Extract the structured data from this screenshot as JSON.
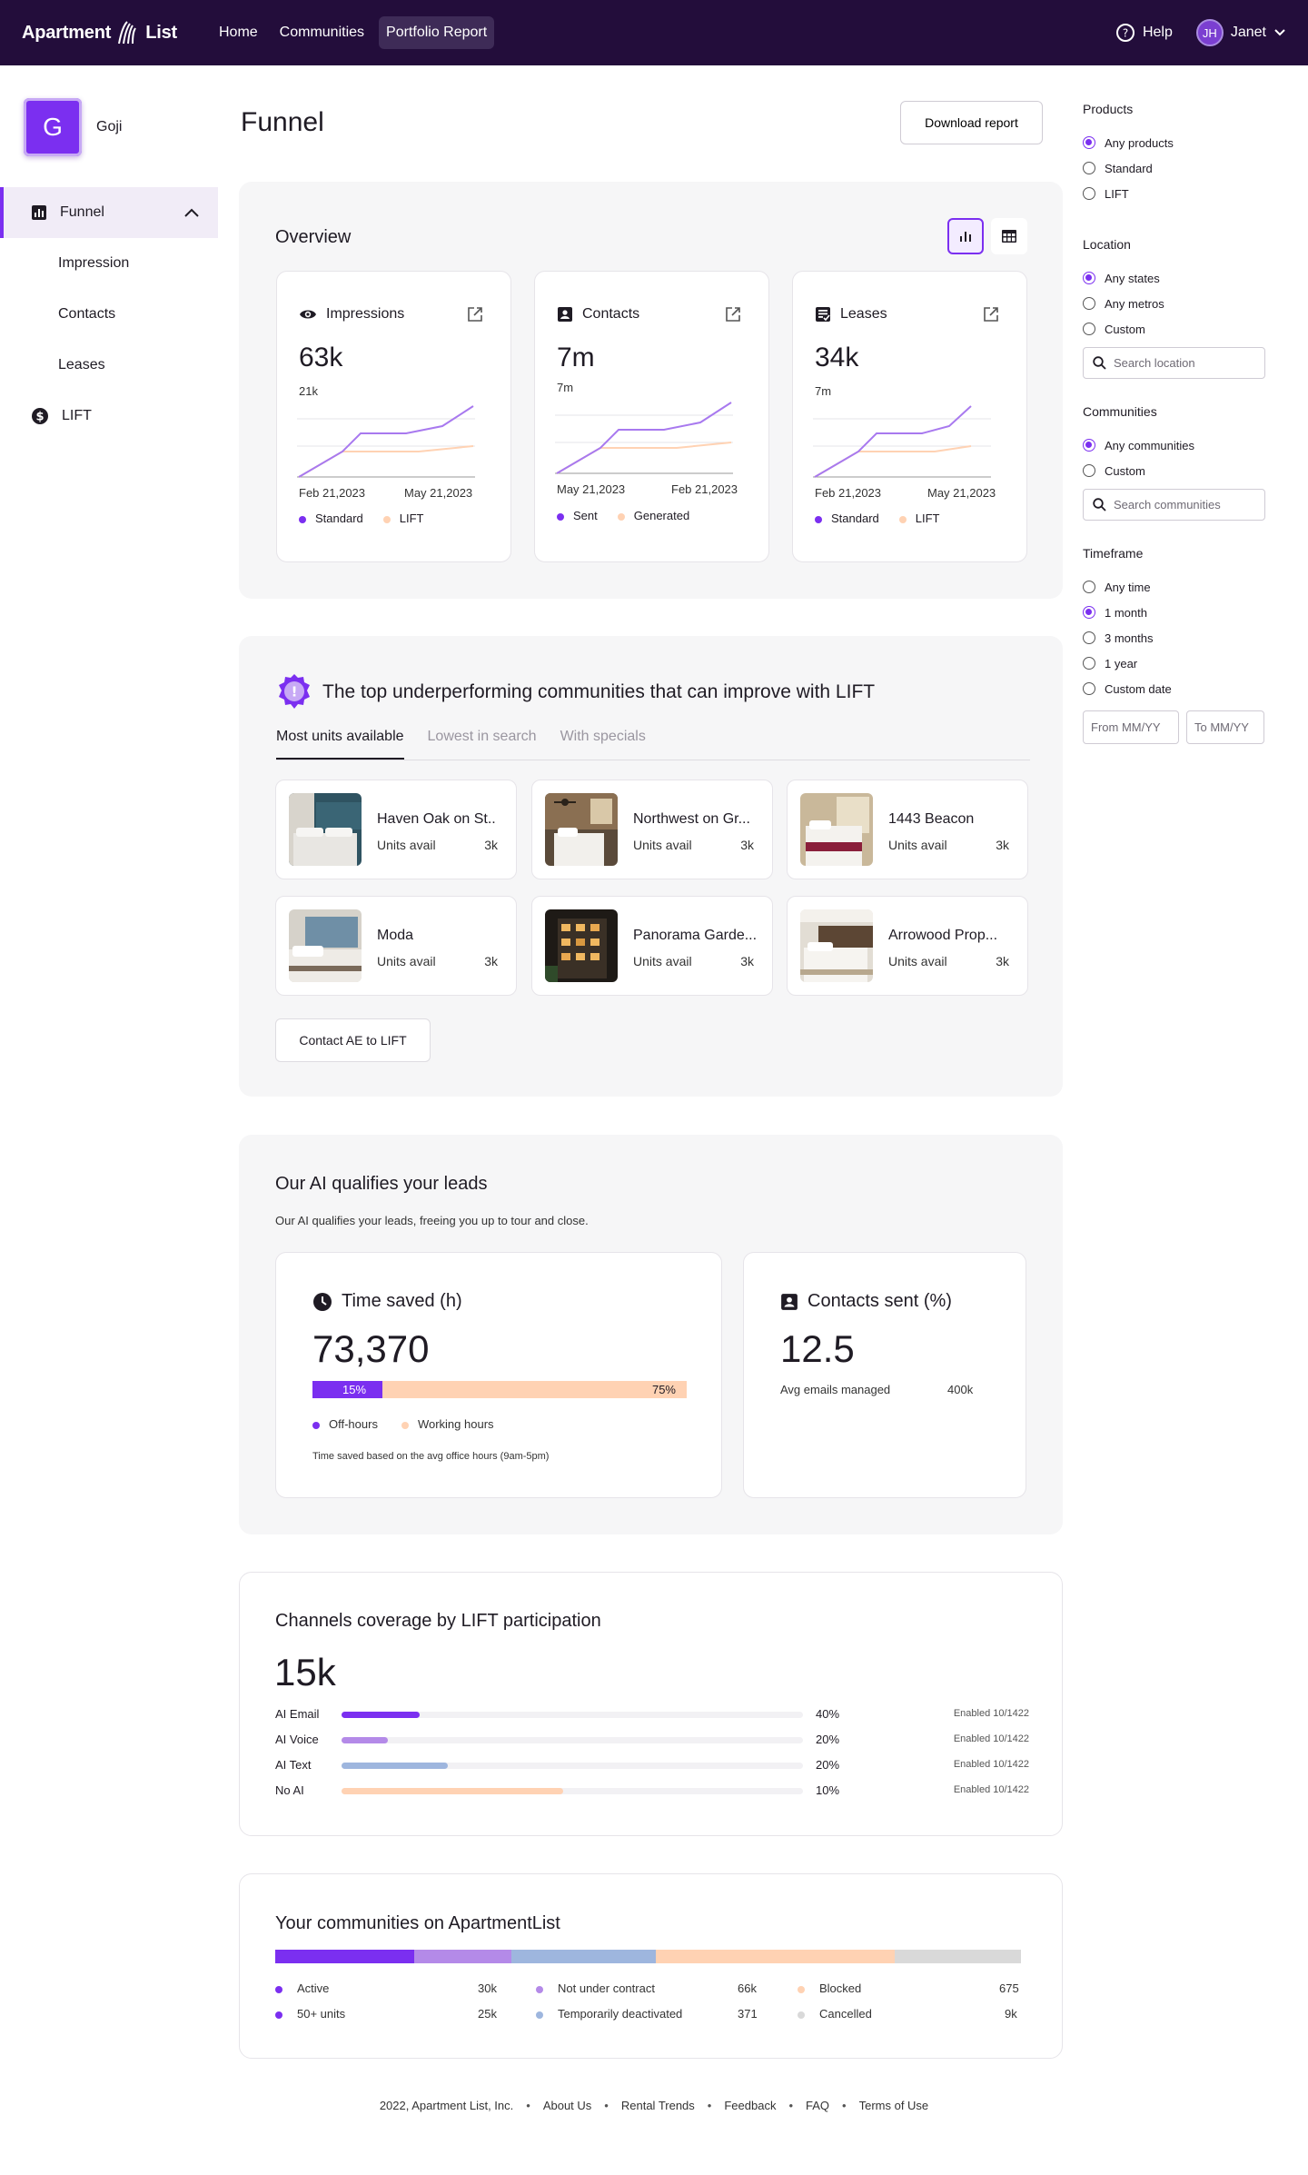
{
  "nav": {
    "logo": "Apartment List",
    "links": [
      "Home",
      "Communities",
      "Portfolio Report"
    ],
    "help": "Help",
    "user_initials": "JH",
    "user_name": "Janet"
  },
  "sidebar": {
    "company_initial": "G",
    "company_name": "Goji",
    "funnel": "Funnel",
    "sub": [
      "Impression",
      "Contacts",
      "Leases"
    ],
    "lift": "LIFT"
  },
  "page": {
    "title": "Funnel",
    "download": "Download report"
  },
  "overview": {
    "title": "Overview",
    "cards": [
      {
        "title": "Impressions",
        "value": "63k",
        "sub": "21k",
        "date_left": "Feb 21,2023",
        "date_right": "May 21,2023",
        "legend": [
          "Standard",
          "LIFT"
        ]
      },
      {
        "title": "Contacts",
        "value": "7m",
        "sub": "7m",
        "date_left": "May 21,2023",
        "date_right": "Feb 21,2023",
        "legend": [
          "Sent",
          "Generated"
        ]
      },
      {
        "title": "Leases",
        "value": "34k",
        "sub": "7m",
        "date_left": "Feb 21,2023",
        "date_right": "May 21,2023",
        "legend": [
          "Standard",
          "LIFT"
        ]
      }
    ]
  },
  "under": {
    "title": "The top underperforming communities that can improve with LIFT",
    "tabs": [
      "Most units available",
      "Lowest in search",
      "With specials"
    ],
    "unit_label": "Units avail",
    "communities": [
      {
        "name": "Haven Oak on St..",
        "units": "3k"
      },
      {
        "name": "Northwest on Gr...",
        "units": "3k"
      },
      {
        "name": "1443 Beacon",
        "units": "3k"
      },
      {
        "name": "Moda",
        "units": "3k"
      },
      {
        "name": "Panorama Garde...",
        "units": "3k"
      },
      {
        "name": "Arrowood Prop...",
        "units": "3k"
      }
    ],
    "contact_btn": "Contact AE to LIFT"
  },
  "ai": {
    "title": "Our AI qualifies your leads",
    "subtitle": "Our AI qualifies your leads, freeing you up to tour and close.",
    "time_title": "Time saved (h)",
    "time_value": "73,370",
    "offhours_pct": 15,
    "offhours_label": "15%",
    "working_label": "75%",
    "legend": [
      "Off-hours",
      "Working hours"
    ],
    "note": "Time saved based on the avg office hours (9am-5pm)",
    "contacts_title": "Contacts sent (%)",
    "contacts_value": "12.5",
    "emails_label": "Avg emails managed",
    "emails_value": "400k"
  },
  "channels": {
    "title": "Channels coverage by LIFT participation",
    "value": "15k",
    "rows": [
      {
        "label": "AI Email",
        "pct": "40%",
        "fill": 17,
        "color": "#7b2ff0",
        "enabled": "Enabled 10/1422"
      },
      {
        "label": "AI Voice",
        "pct": "20%",
        "fill": 10,
        "color": "#b48ae8",
        "enabled": "Enabled 10/1422"
      },
      {
        "label": "AI Text",
        "pct": "20%",
        "fill": 23,
        "color": "#9eb6de",
        "enabled": "Enabled 10/1422"
      },
      {
        "label": "No AI",
        "pct": "10%",
        "fill": 48,
        "color": "#ffd2b3",
        "enabled": "Enabled 10/1422"
      }
    ]
  },
  "communities": {
    "title": "Your communities on ApartmentList",
    "items": [
      {
        "label": "Active",
        "value": "30k",
        "color": "#7b2ff0"
      },
      {
        "label": "50+ units",
        "value": "25k",
        "color": "#7b2ff0"
      },
      {
        "label": "Not under contract",
        "value": "66k",
        "color": "#b48ae8"
      },
      {
        "label": "Temporarily deactivated",
        "value": "371",
        "color": "#9eb6de"
      },
      {
        "label": "Blocked",
        "value": "675",
        "color": "#ffd2b3"
      },
      {
        "label": "Cancelled",
        "value": "9k",
        "color": "#d9d9d9"
      }
    ]
  },
  "filters": {
    "products": {
      "title": "Products",
      "options": [
        "Any products",
        "Standard",
        "LIFT"
      ]
    },
    "location": {
      "title": "Location",
      "options": [
        "Any states",
        "Any metros",
        "Custom"
      ],
      "search": "Search location"
    },
    "communities": {
      "title": "Communities",
      "options": [
        "Any communities",
        "Custom"
      ],
      "search": "Search communities"
    },
    "timeframe": {
      "title": "Timeframe",
      "options": [
        "Any time",
        "1 month",
        "3 months",
        "1 year",
        "Custom date"
      ],
      "from": "From MM/YY",
      "to": "To MM/YY"
    }
  },
  "footer": [
    "2022, Apartment List, Inc.",
    "About Us",
    "Rental Trends",
    "Feedback",
    "FAQ",
    "Terms of Use"
  ]
}
